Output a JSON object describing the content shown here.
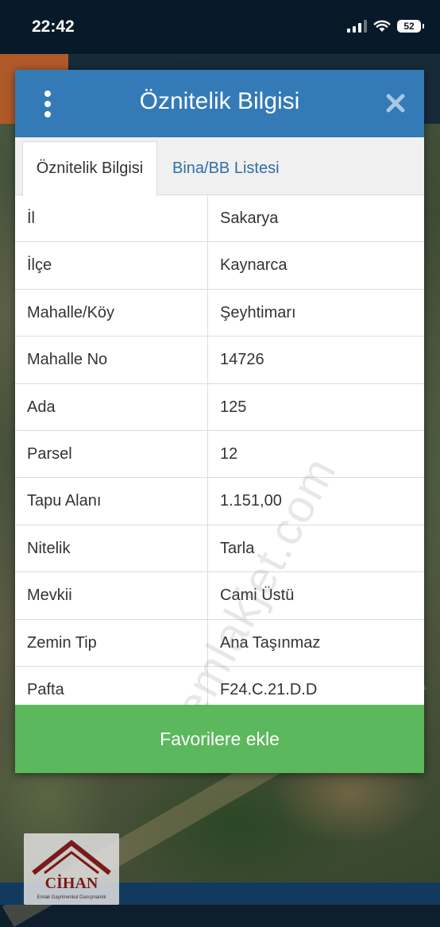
{
  "status_bar": {
    "time": "22:42",
    "battery": "52"
  },
  "dialog": {
    "title": "Öznitelik Bilgisi",
    "tabs": [
      {
        "label": "Öznitelik Bilgisi",
        "active": true
      },
      {
        "label": "Bina/BB Listesi",
        "active": false
      }
    ],
    "rows": [
      {
        "label": "İl",
        "value": "Sakarya"
      },
      {
        "label": "İlçe",
        "value": "Kaynarca"
      },
      {
        "label": "Mahalle/Köy",
        "value": "Şeyhtimarı"
      },
      {
        "label": "Mahalle No",
        "value": "14726"
      },
      {
        "label": "Ada",
        "value": "125"
      },
      {
        "label": "Parsel",
        "value": "12"
      },
      {
        "label": "Tapu Alanı",
        "value": "1.151,00"
      },
      {
        "label": "Nitelik",
        "value": "Tarla"
      },
      {
        "label": "Mevkii",
        "value": "Cami Üstü"
      },
      {
        "label": "Zemin Tip",
        "value": "Ana Taşınmaz"
      },
      {
        "label": "Pafta",
        "value": "F24.C.21.D.D"
      }
    ],
    "favorite_button_label": "Favorilere ekle"
  },
  "watermark": "emlakjet.com",
  "logo": {
    "name": "CİHAN",
    "subtitle": "Emlak Gayrimenkul Danışmanlık"
  },
  "colors": {
    "header": "#337ab7",
    "tab_link": "#2f6fa7",
    "favorite_button": "#5cb85c",
    "status_bar": "#081a2a"
  },
  "icons": {
    "menu": "vertical-dots-icon",
    "close": "close-x-icon",
    "signal": "cellular-signal-icon",
    "wifi": "wifi-icon",
    "battery": "battery-icon"
  }
}
